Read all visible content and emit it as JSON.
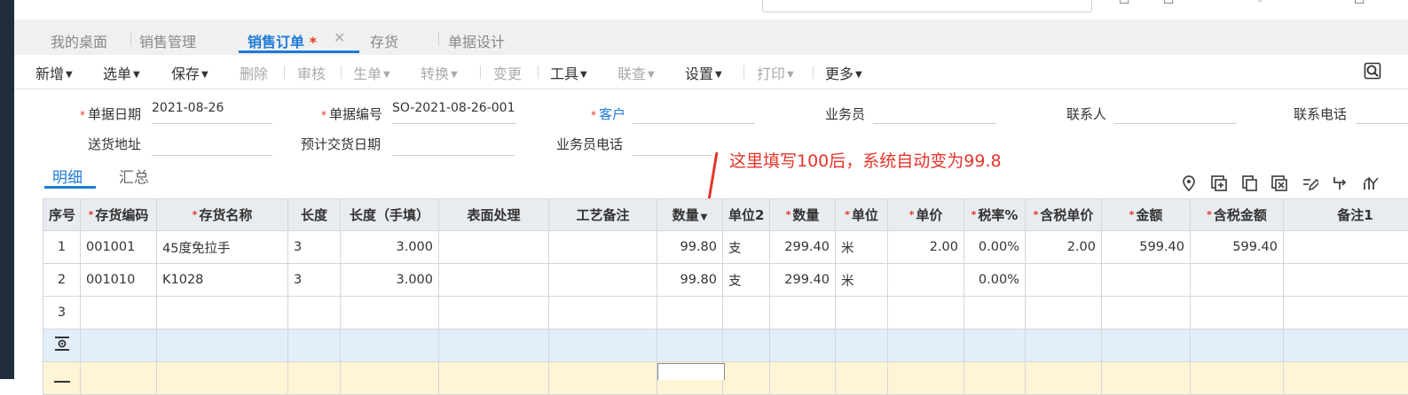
{
  "tabs": [
    {
      "label": "我的桌面"
    },
    {
      "label": "销售管理"
    },
    {
      "label": "销售订单",
      "star": "*"
    },
    {
      "label": "存货"
    },
    {
      "label": "单据设计"
    }
  ],
  "toolbar": {
    "items": [
      {
        "label": "新增"
      },
      {
        "label": "选单"
      },
      {
        "label": "保存"
      },
      {
        "label": "删除"
      },
      {
        "label": "审核"
      },
      {
        "label": "生单"
      },
      {
        "label": "转换"
      },
      {
        "label": "变更"
      },
      {
        "label": "工具"
      },
      {
        "label": "联查"
      },
      {
        "label": "设置"
      },
      {
        "label": "打印"
      },
      {
        "label": "更多"
      }
    ]
  },
  "form": {
    "date_label": "单据日期",
    "date_value": "2021-08-26",
    "code_label": "单据编号",
    "code_value": "SO-2021-08-26-001",
    "customer_label": "客户",
    "salesman_label": "业务员",
    "contact_label": "联系人",
    "phone_label": "联系电话",
    "address_label": "送货地址",
    "delivery_label": "预计交货日期",
    "salesman_phone_label": "业务员电话"
  },
  "annotation": "这里填写100后，系统自动变为99.8",
  "subtabs": [
    "明细",
    "汇总"
  ],
  "grid": {
    "headers": [
      "序号",
      "存货编码",
      "存货名称",
      "长度",
      "长度（手填）",
      "表面处理",
      "工艺备注",
      "数量",
      "单位2",
      "数量",
      "单位",
      "单价",
      "税率%",
      "含税单价",
      "金额",
      "含税金额",
      "备注1"
    ],
    "rows": [
      [
        "1",
        "001001",
        "45度免拉手",
        "3",
        "3.000",
        "",
        "",
        "99.80",
        "支",
        "299.40",
        "米",
        "2.00",
        "0.00%",
        "2.00",
        "599.40",
        "599.40",
        ""
      ],
      [
        "2",
        "001010",
        "K1028",
        "3",
        "3.000",
        "",
        "",
        "99.80",
        "支",
        "299.40",
        "米",
        "",
        "0.00%",
        "",
        "",
        "",
        ""
      ],
      [
        "3",
        "",
        "",
        "",
        "",
        "",
        "",
        "",
        "",
        "",
        "",
        "",
        "",
        "",
        "",
        "",
        ""
      ]
    ]
  },
  "colors": {
    "accent": "#1d7ad9",
    "required": "#e5342a",
    "annotation": "#e5342a"
  }
}
